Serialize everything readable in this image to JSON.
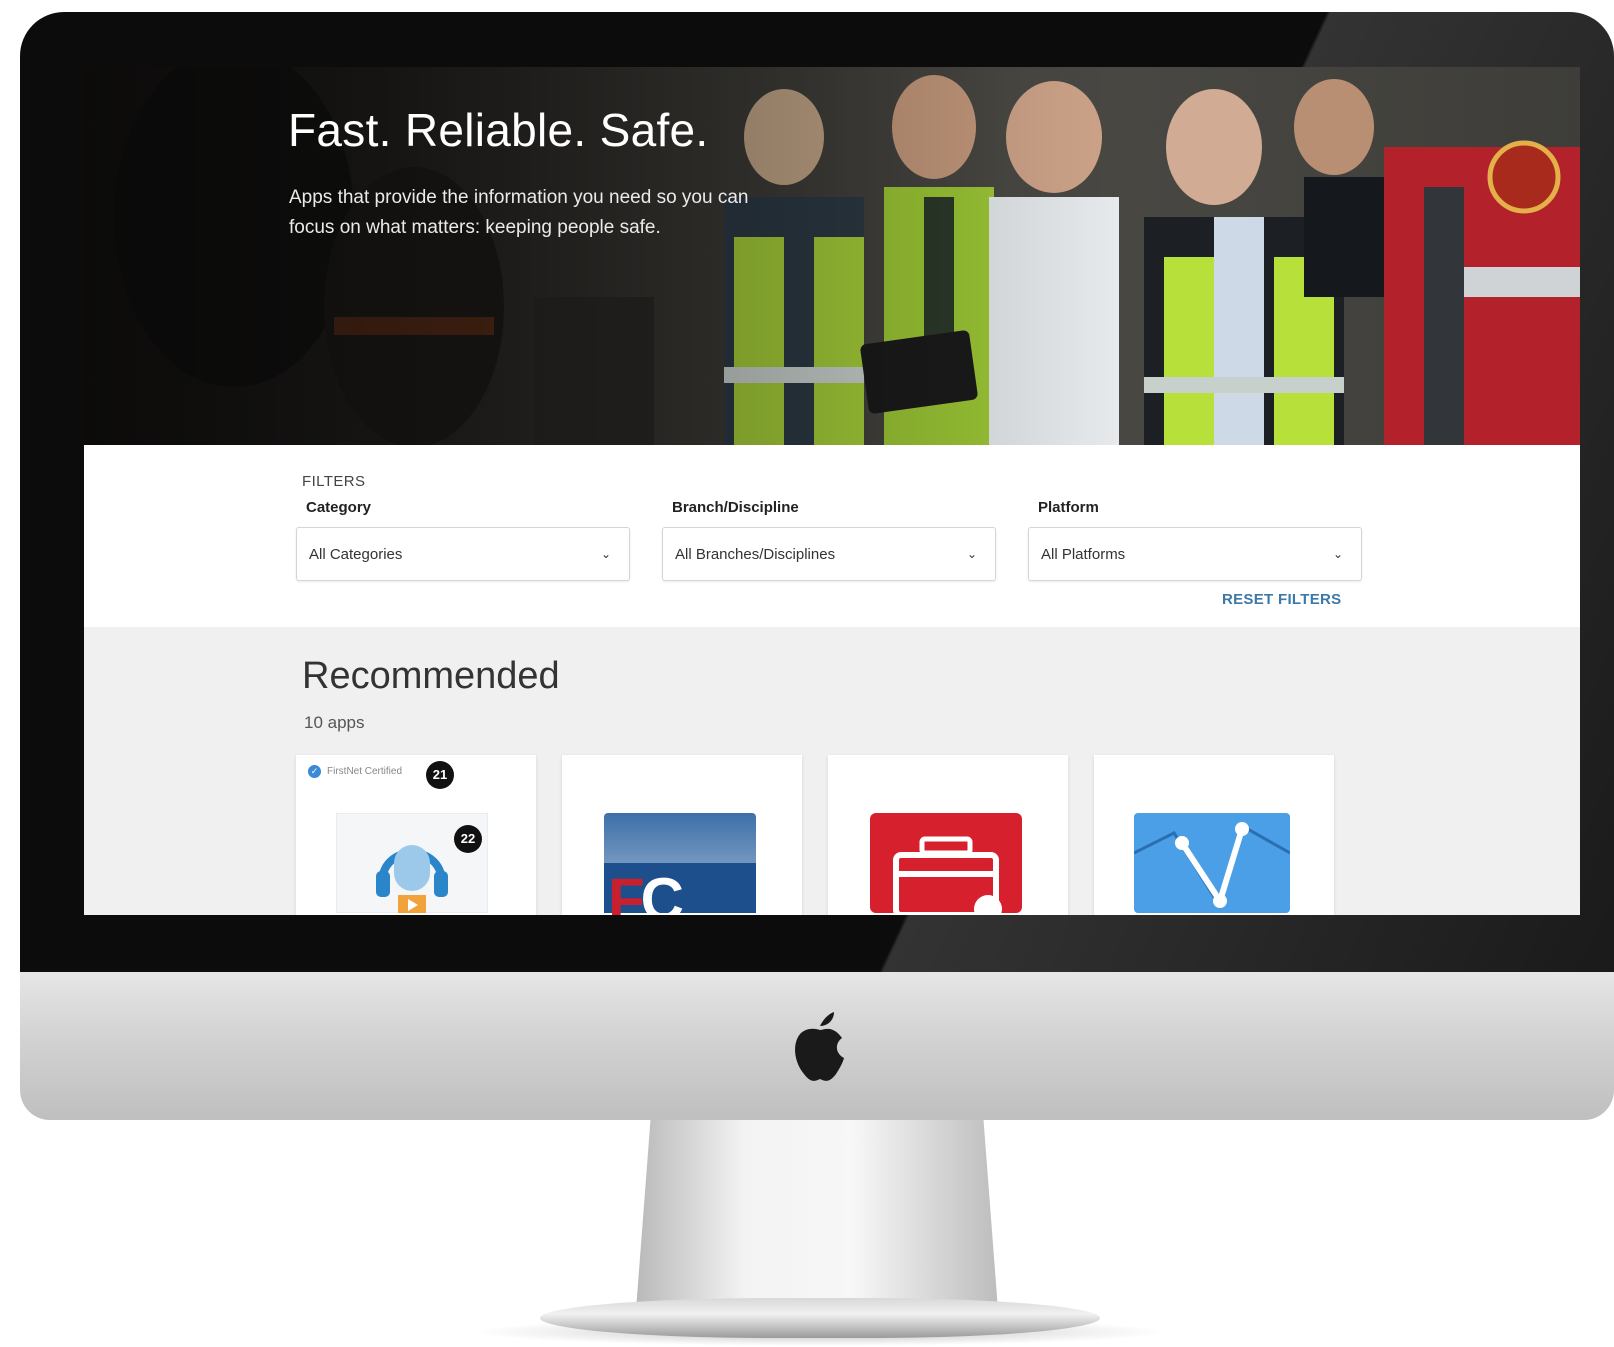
{
  "hero": {
    "title": "Fast. Reliable. Safe.",
    "subtitle": "Apps that provide the information you need so you can focus on what matters: keeping people safe."
  },
  "filters": {
    "section_label": "FILTERS",
    "category": {
      "label": "Category",
      "value": "All Categories"
    },
    "branch": {
      "label": "Branch/Discipline",
      "value": "All Branches/Disciplines"
    },
    "platform": {
      "label": "Platform",
      "value": "All Platforms"
    },
    "reset_label": "RESET FILTERS"
  },
  "recommended": {
    "title": "Recommended",
    "count": "10 apps",
    "cards": [
      {
        "certified": "FirstNet Certified",
        "badge_card": "21",
        "badge_icon": "22",
        "icon": "podcast-microphone-icon"
      },
      {
        "icon": "fc-logo-icon",
        "icon_text": "FC"
      },
      {
        "icon": "briefcase-map-icon"
      },
      {
        "icon": "network-nodes-icon"
      }
    ]
  },
  "colors": {
    "link": "#3c78a8",
    "certified_check": "#3a8ad6",
    "recommended_bg": "#f0f0f0",
    "fc_red": "#c8202e",
    "fc_blue": "#1d4f8c",
    "briefcase_red": "#d6202e",
    "network_blue": "#4a9fe6"
  },
  "chevron": "⌄"
}
